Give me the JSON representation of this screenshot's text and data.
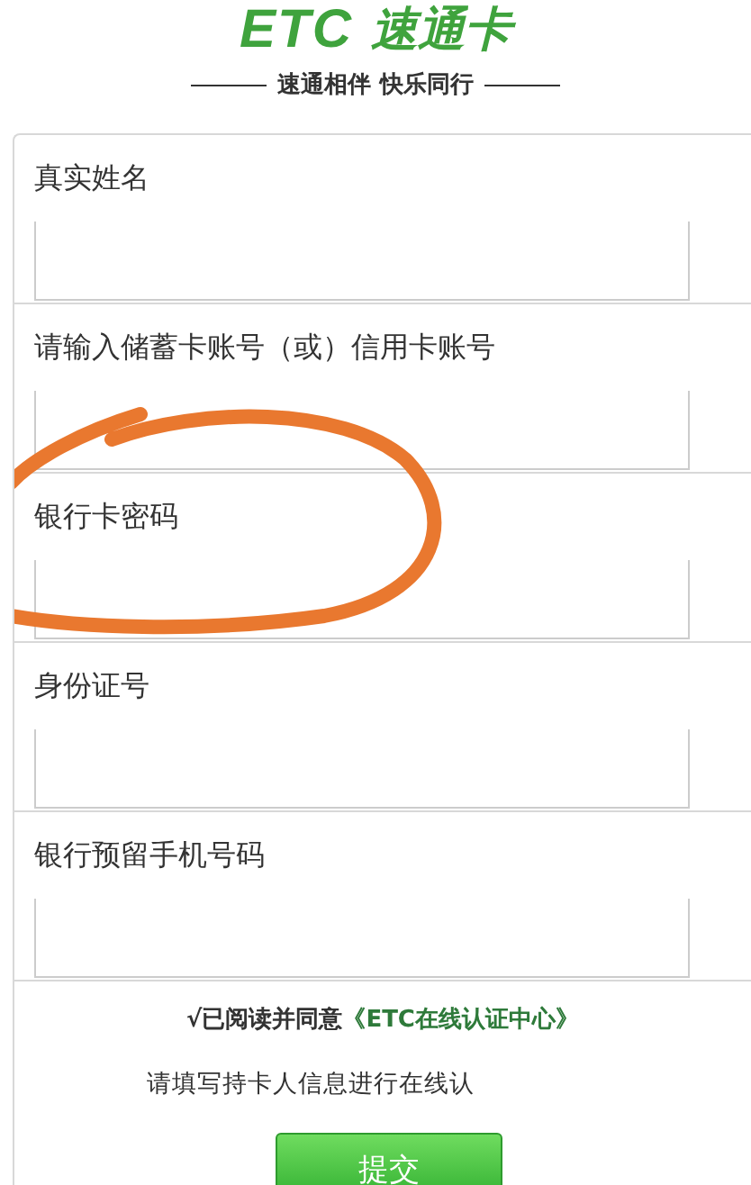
{
  "logo": {
    "brand": "ETC",
    "name": "速通卡"
  },
  "tagline": "速通相伴 快乐同行",
  "fields": [
    {
      "label": "真实姓名"
    },
    {
      "label": "请输入储蓄卡账号（或）信用卡账号"
    },
    {
      "label": "银行卡密码"
    },
    {
      "label": "身份证号"
    },
    {
      "label": "银行预留手机号码"
    }
  ],
  "agreement": {
    "text": "√已阅读并同意",
    "link": "《ETC在线认证中心》"
  },
  "notice": "请填写持卡人信息进行在线认",
  "submit": "提交"
}
